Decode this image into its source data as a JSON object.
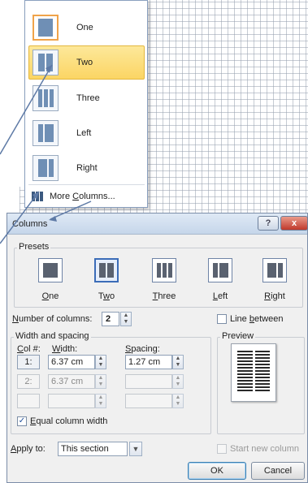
{
  "menu": {
    "items": [
      {
        "label": "One"
      },
      {
        "label": "Two"
      },
      {
        "label": "Three"
      },
      {
        "label": "Left"
      },
      {
        "label": "Right"
      }
    ],
    "more_label_pre": "More ",
    "more_label_u": "C",
    "more_label_post": "olumns..."
  },
  "dialog": {
    "title": "Columns",
    "help": "?",
    "close": "x",
    "presets_label": "Presets",
    "presets": [
      {
        "u": "O",
        "rest": "ne"
      },
      {
        "pre": "T",
        "u": "w",
        "rest": "o"
      },
      {
        "u": "T",
        "rest": "hree"
      },
      {
        "u": "L",
        "rest": "eft"
      },
      {
        "u": "R",
        "rest": "ight"
      }
    ],
    "num_cols_label_u": "N",
    "num_cols_label_rest": "umber of columns:",
    "num_cols_value": "2",
    "line_between_pre": "Line ",
    "line_between_u": "b",
    "line_between_post": "etween",
    "width_spacing_label": "Width and spacing",
    "col_header_u": "C",
    "col_header_rest": "ol #:",
    "width_header_u": "W",
    "width_header_rest": "idth:",
    "spacing_header_u": "S",
    "spacing_header_rest": "pacing:",
    "rows": [
      {
        "col": "1:",
        "width": "6.37 cm",
        "spacing": "1.27 cm"
      },
      {
        "col": "2:",
        "width": "6.37 cm",
        "spacing": ""
      },
      {
        "col": "",
        "width": "",
        "spacing": ""
      }
    ],
    "equal_width_u": "E",
    "equal_width_rest": "qual column width",
    "preview_label": "Preview",
    "apply_to_u": "A",
    "apply_to_rest": "pply to:",
    "apply_to_value": "This section",
    "start_new_column": "Start new column",
    "ok": "OK",
    "cancel": "Cancel"
  }
}
